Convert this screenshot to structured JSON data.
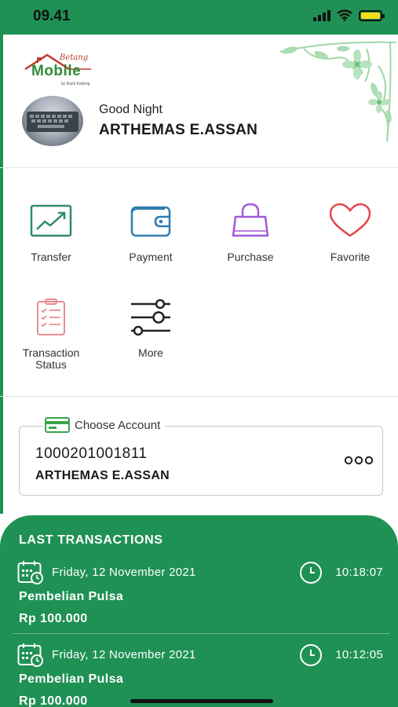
{
  "status_bar": {
    "time": "09.41"
  },
  "header": {
    "logo": {
      "script": "Betang",
      "main": "Mobile",
      "sub": "by Bank Kalteng"
    },
    "greeting": "Good Night",
    "user_name": "ARTHEMAS E.ASSAN"
  },
  "menu": [
    {
      "label": "Transfer",
      "icon": "chart-trend-icon"
    },
    {
      "label": "Payment",
      "icon": "wallet-icon"
    },
    {
      "label": "Purchase",
      "icon": "shopping-bag-icon"
    },
    {
      "label": "Favorite",
      "icon": "heart-icon"
    },
    {
      "label": "Transaction Status",
      "icon": "clipboard-checklist-icon"
    },
    {
      "label": "More",
      "icon": "sliders-icon"
    }
  ],
  "account": {
    "legend": "Choose Account",
    "number": "1000201001811",
    "name": "ARTHEMAS E.ASSAN"
  },
  "transactions": {
    "title": "LAST TRANSACTIONS",
    "items": [
      {
        "date": "Friday, 12 November 2021",
        "time": "10:18:07",
        "description": "Pembelian Pulsa",
        "amount": "Rp 100.000"
      },
      {
        "date": "Friday, 12 November 2021",
        "time": "10:12:05",
        "description": "Pembelian Pulsa",
        "amount": "Rp 100.000"
      }
    ]
  },
  "colors": {
    "brand_green": "#1f9154",
    "transfer_icon": "#2e8b6a",
    "payment_icon": "#2f7db0",
    "purchase_icon": "#a259d9",
    "favorite_icon": "#e0474c",
    "status_icon": "#e88d8d"
  }
}
